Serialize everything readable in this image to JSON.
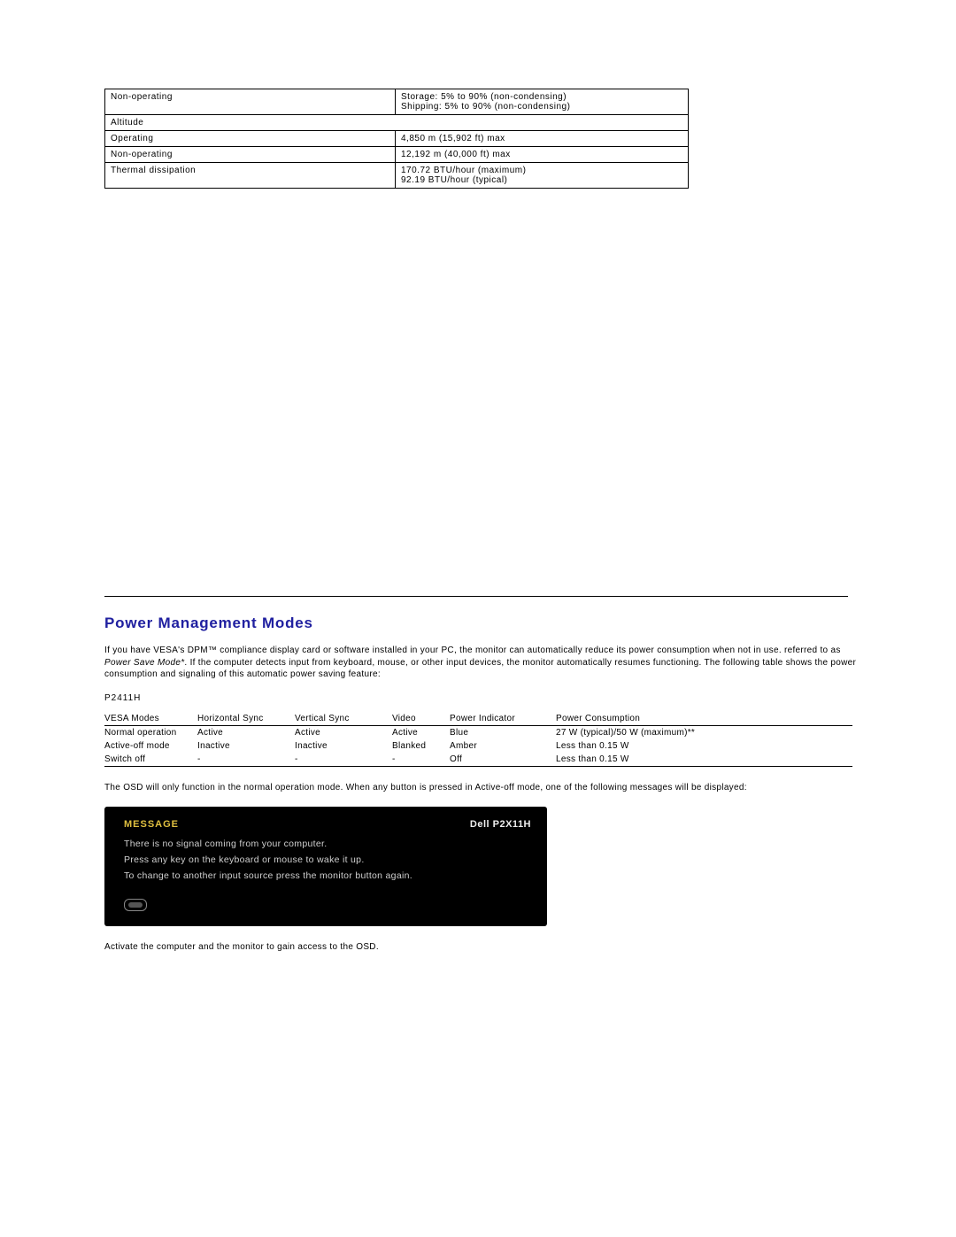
{
  "env_table": {
    "rows": [
      {
        "label": "Non-operating",
        "value": "Storage: 5% to 90% (non-condensing)\nShipping: 5% to 90% (non-condensing)"
      },
      {
        "label": "Altitude",
        "value": ""
      },
      {
        "label": "Operating",
        "value": "4,850 m (15,902 ft) max"
      },
      {
        "label": "Non-operating",
        "value": "12,192 m (40,000 ft) max"
      },
      {
        "label": "Thermal dissipation",
        "value": "170.72 BTU/hour (maximum)\n92.19 BTU/hour (typical)"
      }
    ]
  },
  "section": {
    "title": "Power Management Modes",
    "intro_part1": "If you have VESA's DPM™ compliance display card or software installed in your PC, the monitor can automatically reduce its power consumption when not in use. referred to as ",
    "intro_italic": "Power Save Mode*",
    "intro_part2": ". If the computer detects input from keyboard, mouse, or other input devices, the monitor automatically resumes functioning. The following table shows the power consumption and signaling of this automatic power saving feature:",
    "model": "P2411H"
  },
  "power_table": {
    "headers": [
      "VESA Modes",
      "Horizontal Sync",
      "Vertical Sync",
      "Video",
      "Power Indicator",
      "Power Consumption"
    ],
    "rows": [
      [
        "Normal operation",
        "Active",
        "Active",
        "Active",
        "Blue",
        "27 W (typical)/50 W (maximum)**"
      ],
      [
        "Active-off mode",
        "Inactive",
        "Inactive",
        "Blanked",
        "Amber",
        "Less than 0.15 W"
      ],
      [
        "Switch off",
        "-",
        "-",
        "-",
        "Off",
        "Less than 0.15 W"
      ]
    ]
  },
  "osd_note": "The OSD will only function in the normal operation mode. When any button is pressed in Active-off mode, one of the following messages will be displayed:",
  "osd_box": {
    "message_label": "MESSAGE",
    "model": "Dell P2X11H",
    "line1": "There is no signal coming from your computer.",
    "line2": "Press any key on the keyboard or mouse to wake it up.",
    "line3": "To change to another input source press the monitor button again."
  },
  "activate_note": "Activate the computer and the monitor to gain access to the OSD."
}
